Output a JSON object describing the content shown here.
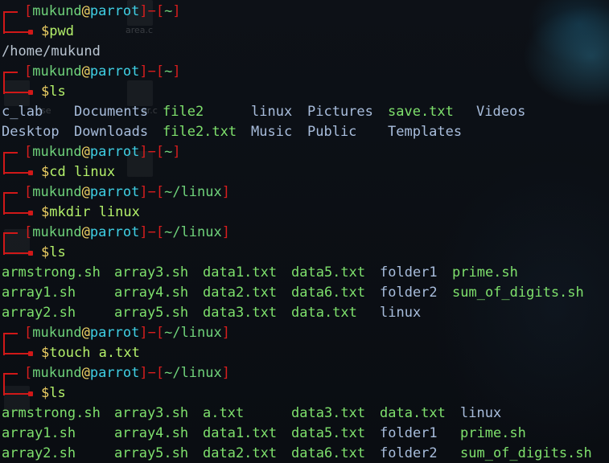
{
  "background_hints": {
    "ghost_labels": [
      "area.c",
      "ise",
      "ar.c"
    ]
  },
  "colors": {
    "prompt_bracket": "#d81e1e",
    "user": "#6fd27a",
    "host": "#3fd0e5",
    "directory_entry": "#a8bddc",
    "file_entry": "#7ee06c"
  },
  "session": [
    {
      "type": "prompt",
      "user": "mukund",
      "at": "@",
      "host": "parrot",
      "dash": "−",
      "cwd": "~",
      "dollar": "$",
      "command": "pwd"
    },
    {
      "type": "output",
      "text": "/home/mukund"
    },
    {
      "type": "prompt",
      "user": "mukund",
      "at": "@",
      "host": "parrot",
      "dash": "−",
      "cwd": "~",
      "dollar": "$",
      "command": "ls"
    },
    {
      "type": "listing",
      "rows": [
        [
          {
            "t": "c_lab",
            "k": "folder"
          },
          {
            "t": "Documents",
            "k": "folder"
          },
          {
            "t": "file2",
            "k": "file"
          },
          {
            "t": "linux",
            "k": "folder"
          },
          {
            "t": "Pictures",
            "k": "folder"
          },
          {
            "t": "save.txt",
            "k": "file"
          },
          {
            "t": "Videos",
            "k": "folder"
          }
        ],
        [
          {
            "t": "Desktop",
            "k": "folder"
          },
          {
            "t": "Downloads",
            "k": "folder"
          },
          {
            "t": "file2.txt",
            "k": "file"
          },
          {
            "t": "Music",
            "k": "folder"
          },
          {
            "t": "Public",
            "k": "folder"
          },
          {
            "t": "Templates",
            "k": "folder"
          }
        ]
      ]
    },
    {
      "type": "prompt",
      "user": "mukund",
      "at": "@",
      "host": "parrot",
      "dash": "−",
      "cwd": "~",
      "dollar": "$",
      "command": "cd linux"
    },
    {
      "type": "prompt",
      "user": "mukund",
      "at": "@",
      "host": "parrot",
      "dash": "−",
      "cwd": "~/linux",
      "dollar": "$",
      "command": "mkdir linux"
    },
    {
      "type": "prompt",
      "user": "mukund",
      "at": "@",
      "host": "parrot",
      "dash": "−",
      "cwd": "~/linux",
      "dollar": "$",
      "command": "ls"
    },
    {
      "type": "listing",
      "rows": [
        [
          {
            "t": "armstrong.sh",
            "k": "file"
          },
          {
            "t": "array3.sh",
            "k": "file"
          },
          {
            "t": "data1.txt",
            "k": "file"
          },
          {
            "t": "data5.txt",
            "k": "file"
          },
          {
            "t": "folder1",
            "k": "folder"
          },
          {
            "t": "prime.sh",
            "k": "file"
          }
        ],
        [
          {
            "t": "array1.sh",
            "k": "file"
          },
          {
            "t": "array4.sh",
            "k": "file"
          },
          {
            "t": "data2.txt",
            "k": "file"
          },
          {
            "t": "data6.txt",
            "k": "file"
          },
          {
            "t": "folder2",
            "k": "folder"
          },
          {
            "t": "sum_of_digits.sh",
            "k": "file"
          }
        ],
        [
          {
            "t": "array2.sh",
            "k": "file"
          },
          {
            "t": "array5.sh",
            "k": "file"
          },
          {
            "t": "data3.txt",
            "k": "file"
          },
          {
            "t": "data.txt",
            "k": "file"
          },
          {
            "t": "linux",
            "k": "folder"
          }
        ]
      ]
    },
    {
      "type": "prompt",
      "user": "mukund",
      "at": "@",
      "host": "parrot",
      "dash": "−",
      "cwd": "~/linux",
      "dollar": "$",
      "command": "touch a.txt"
    },
    {
      "type": "prompt",
      "user": "mukund",
      "at": "@",
      "host": "parrot",
      "dash": "−",
      "cwd": "~/linux",
      "dollar": "$",
      "command": "ls"
    },
    {
      "type": "listing",
      "rows": [
        [
          {
            "t": "armstrong.sh",
            "k": "file"
          },
          {
            "t": "array3.sh",
            "k": "file"
          },
          {
            "t": "a.txt",
            "k": "file"
          },
          {
            "t": "data3.txt",
            "k": "file"
          },
          {
            "t": "data.txt",
            "k": "file"
          },
          {
            "t": "linux",
            "k": "folder"
          }
        ],
        [
          {
            "t": "array1.sh",
            "k": "file"
          },
          {
            "t": "array4.sh",
            "k": "file"
          },
          {
            "t": "data1.txt",
            "k": "file"
          },
          {
            "t": "data5.txt",
            "k": "file"
          },
          {
            "t": "folder1",
            "k": "folder"
          },
          {
            "t": "prime.sh",
            "k": "file"
          }
        ],
        [
          {
            "t": "array2.sh",
            "k": "file"
          },
          {
            "t": "array5.sh",
            "k": "file"
          },
          {
            "t": "data2.txt",
            "k": "file"
          },
          {
            "t": "data6.txt",
            "k": "file"
          },
          {
            "t": "folder2",
            "k": "folder"
          },
          {
            "t": "sum_of_digits.sh",
            "k": "file"
          }
        ]
      ]
    }
  ]
}
